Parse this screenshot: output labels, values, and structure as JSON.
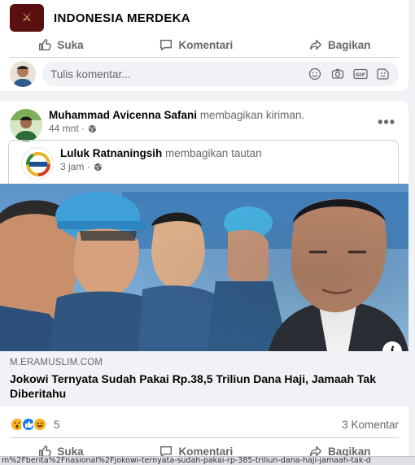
{
  "page": {
    "name": "INDONESIA MERDEKA"
  },
  "actions": {
    "like": "Suka",
    "comment": "Komentari",
    "share": "Bagikan"
  },
  "comment_input": {
    "placeholder": "Tulis komentar..."
  },
  "post": {
    "author": "Muhammad Avicenna Safani",
    "shared_text": "membagikan kiriman.",
    "time": "44 mnt ·",
    "inner_author": "Luluk Ratnaningsih",
    "inner_shared_text": "membagikan tautan",
    "inner_time": "3 jam ·",
    "link": {
      "domain": "M.ERAMUSLIM.COM",
      "title": "Jokowi Ternyata Sudah Pakai Rp.38,5 Triliun Dana Haji, Jamaah Tak Diberitahu"
    },
    "reaction_count": "5",
    "comment_count": "3 Komentar"
  },
  "statusbar": {
    "url": "m%2Fberita%2Fnasional%2Fjokowi-ternyata-sudah-pakai-rp-385-triliun-dana-haji-jamaah-tak-d"
  },
  "colors": {
    "accent": "#1877f2",
    "muted": "#65676b"
  }
}
